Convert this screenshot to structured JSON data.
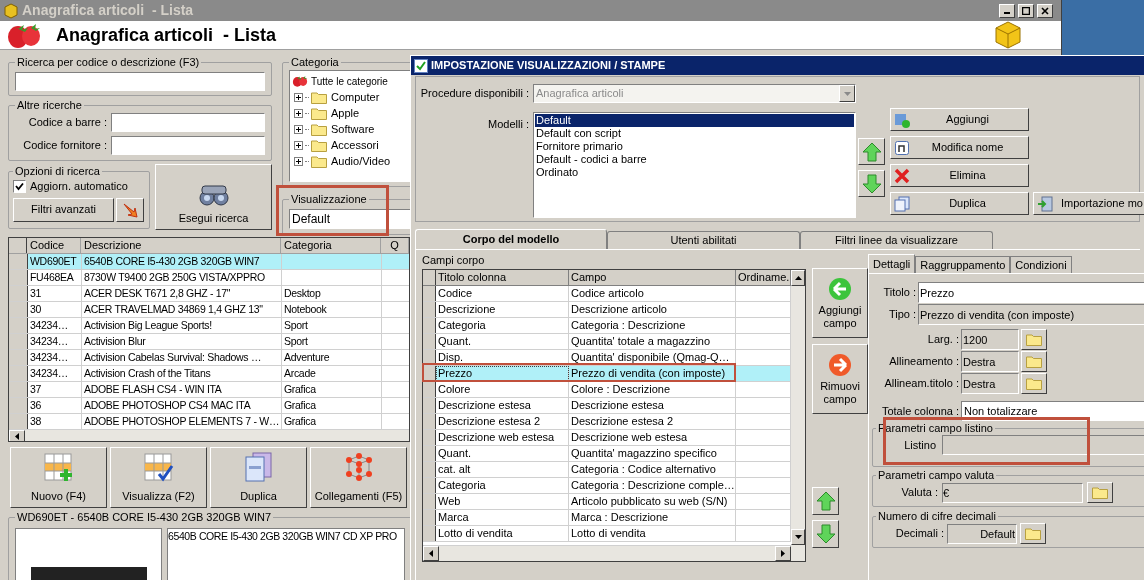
{
  "main_window": {
    "title": "Anagrafica articoli  - Lista",
    "header_title": "Anagrafica articoli  - Lista",
    "search": {
      "label": "Ricerca per codice o descrizione (F3)"
    },
    "other_searches": {
      "label": "Altre ricerche",
      "fields": [
        {
          "label": "Codice a barre :"
        },
        {
          "label": "Codice fornitore :"
        }
      ]
    },
    "options": {
      "label": "Opzioni di ricerca",
      "auto_update": {
        "label": "Aggiorn. automatico",
        "checked": true
      },
      "advanced_filters": "Filtri avanzati"
    },
    "run_search": "Esegui ricerca",
    "category": {
      "label": "Categoria",
      "tree": [
        {
          "label": "Tutte le categorie",
          "children": [
            {
              "label": "Computer",
              "expanded": false
            },
            {
              "label": "Apple",
              "expanded": false
            },
            {
              "label": "Software",
              "expanded": false
            },
            {
              "label": "Accessori",
              "expanded": false
            },
            {
              "label": "Audio/Video",
              "expanded": false
            }
          ]
        }
      ]
    },
    "view": {
      "label": "Visualizzazione",
      "value": "Default"
    },
    "table": {
      "columns": [
        "Codice",
        "Descrizione",
        "Categoria",
        "Q"
      ],
      "rows": [
        {
          "cells": [
            "WD690ET",
            "6540B CORE I5-430 2GB 320GB WIN7",
            ""
          ],
          "selected": true
        },
        {
          "cells": [
            "FU468EA",
            "8730W T9400 2GB 250G VISTA/XPPRO",
            ""
          ],
          "selected": false
        },
        {
          "cells": [
            "31",
            "ACER DESK T671 2,8 GHZ - 17\"",
            "Desktop"
          ],
          "selected": false
        },
        {
          "cells": [
            "30",
            "ACER TRAVELMAD 34869 1,4 GHZ 13\"",
            "Notebook"
          ],
          "selected": false
        },
        {
          "cells": [
            "34234…",
            "Activision Big League Sports!",
            "Sport"
          ],
          "selected": false
        },
        {
          "cells": [
            "34234…",
            "Activision Blur",
            "Sport"
          ],
          "selected": false
        },
        {
          "cells": [
            "34234…",
            "Activision Cabelas Survival: Shadows …",
            "Adventure"
          ],
          "selected": false
        },
        {
          "cells": [
            "34234…",
            "Activision Crash of the Titans",
            "Arcade"
          ],
          "selected": false
        },
        {
          "cells": [
            "37",
            "ADOBE FLASH CS4 - WIN ITA",
            "Grafica"
          ],
          "selected": false
        },
        {
          "cells": [
            "36",
            "ADOBE PHOTOSHOP CS4 MAC ITA",
            "Grafica"
          ],
          "selected": false
        },
        {
          "cells": [
            "38",
            "ADOBE PHOTOSHOP ELEMENTS 7 - W…",
            "Grafica"
          ],
          "selected": false
        }
      ]
    },
    "actions": [
      {
        "label": "Nuovo (F4)",
        "kind": "new"
      },
      {
        "label": "Visualizza (F2)",
        "kind": "view"
      },
      {
        "label": "Duplica",
        "kind": "duplicate"
      },
      {
        "label": "Collegamenti (F5)",
        "kind": "links"
      }
    ],
    "detail": {
      "title": "WD690ET - 6540B CORE I5-430 2GB 320GB WIN7",
      "description": "6540B CORE I5-430 2GB 320GB WIN7 CD XP PRO"
    }
  },
  "dialog": {
    "title": "IMPOSTAZIONE VISUALIZZAZIONI / STAMPE",
    "procedure": {
      "label": "Procedure disponibili :",
      "value": "Anagrafica articoli",
      "disabled": true
    },
    "models": {
      "label": "Modelli :",
      "items": [
        {
          "label": "Default",
          "selected": true
        },
        {
          "label": "Default con script",
          "selected": false
        },
        {
          "label": "Fornitore primario",
          "selected": false
        },
        {
          "label": "Default - codici a barre",
          "selected": false
        },
        {
          "label": "Ordinato",
          "selected": false
        }
      ]
    },
    "model_buttons": [
      {
        "label": "Aggiungi",
        "kind": "add"
      },
      {
        "label": "Modifica nome",
        "kind": "rename"
      },
      {
        "label": "Elimina",
        "kind": "delete"
      },
      {
        "label": "Duplica",
        "kind": "duplicate"
      },
      {
        "label": "Importazione mo",
        "kind": "import"
      }
    ],
    "tabs": [
      {
        "label": "Corpo del modello",
        "selected": true
      },
      {
        "label": "Utenti abilitati",
        "selected": false
      },
      {
        "label": "Filtri linee da visualizzare",
        "selected": false
      }
    ],
    "fields_grid": {
      "label": "Campi corpo",
      "columns": [
        "Titolo colonna",
        "Campo",
        "Ordiname."
      ],
      "rows": [
        {
          "cells": [
            "Codice",
            "Codice articolo"
          ],
          "selected": false
        },
        {
          "cells": [
            "Descrizione",
            "Descrizione articolo"
          ],
          "selected": false
        },
        {
          "cells": [
            "Categoria",
            "Categoria : Descrizione"
          ],
          "selected": false
        },
        {
          "cells": [
            "Quant.",
            "Quantita' totale a magazzino"
          ],
          "selected": false
        },
        {
          "cells": [
            "Disp.",
            "Quantita' disponibile (Qmag-Q…"
          ],
          "selected": false
        },
        {
          "cells": [
            "Prezzo",
            "Prezzo di vendita (con imposte)"
          ],
          "selected": true
        },
        {
          "cells": [
            "Colore",
            "Colore : Descrizione"
          ],
          "selected": false
        },
        {
          "cells": [
            "Descrizione estesa",
            "Descrizione estesa"
          ],
          "selected": false
        },
        {
          "cells": [
            "Descrizione estesa 2",
            "Descrizione estesa 2"
          ],
          "selected": false
        },
        {
          "cells": [
            "Descrizione web estesa",
            "Descrizione web estesa"
          ],
          "selected": false
        },
        {
          "cells": [
            "Quant.",
            "Quantita' magazzino specifico"
          ],
          "selected": false
        },
        {
          "cells": [
            "cat. alt",
            "Categoria : Codice alternativo"
          ],
          "selected": false
        },
        {
          "cells": [
            "Categoria",
            "Categoria : Descrizione comple…"
          ],
          "selected": false
        },
        {
          "cells": [
            "Web",
            "Articolo pubblicato su web (S/N)"
          ],
          "selected": false
        },
        {
          "cells": [
            "Marca",
            "Marca : Descrizione"
          ],
          "selected": false
        },
        {
          "cells": [
            "Lotto di vendita",
            "Lotto di vendita"
          ],
          "selected": false
        }
      ]
    },
    "field_buttons": [
      {
        "label": "Aggiungi campo",
        "kind": "add"
      },
      {
        "label": "Rimuovi campo",
        "kind": "remove"
      }
    ],
    "detail_tabs": [
      {
        "label": "Dettagli",
        "selected": true
      },
      {
        "label": "Raggruppamento",
        "selected": false
      },
      {
        "label": "Condizioni",
        "selected": false
      }
    ],
    "details": {
      "title": {
        "label": "Titolo :",
        "value": "Prezzo"
      },
      "type": {
        "label": "Tipo :",
        "value": "Prezzo di vendita (con imposte)"
      },
      "settings": [
        {
          "label": "Larg. :",
          "value": "1200"
        },
        {
          "label": "Allineamento :",
          "value": "Destra"
        },
        {
          "label": "Allineam.titolo :",
          "value": "Destra"
        }
      ],
      "column_total": {
        "label": "Totale colonna :",
        "value": "Non totalizzare"
      },
      "price_list": {
        "label": "Parametri campo listino",
        "field_label": "Listino"
      },
      "currency": {
        "label": "Parametri campo valuta",
        "field_label": "Valuta :",
        "value": "€"
      },
      "decimals": {
        "label": "Numero di cifre decimali",
        "field_label": "Decimali :",
        "value": "Default"
      }
    }
  }
}
